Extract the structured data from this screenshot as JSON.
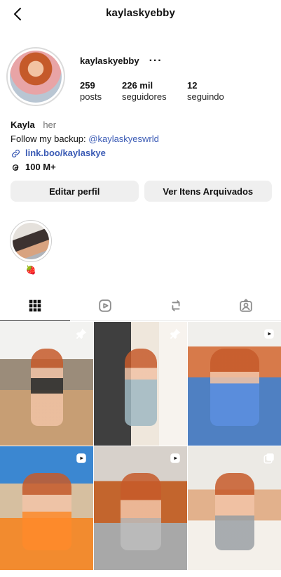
{
  "header": {
    "title": "kaylaskyebby"
  },
  "profile": {
    "username": "kaylaskyebby",
    "more_label": "···",
    "stats": [
      {
        "value": "259",
        "label": "posts"
      },
      {
        "value": "226 mil",
        "label": "seguidores"
      },
      {
        "value": "12",
        "label": "seguindo"
      }
    ],
    "bio": {
      "name": "Kayla",
      "pronouns": "her",
      "line_prefix": "Follow my backup: ",
      "mention": "@kaylaskyeswrld",
      "link": "link.boo/kaylaskye",
      "threads_count": "100 M+"
    },
    "buttons": {
      "edit": "Editar perfil",
      "archived": "Ver Itens Arquivados"
    },
    "highlight": {
      "label": "🍓"
    }
  },
  "tabs": [
    {
      "name": "grid-tab",
      "icon": "grid-icon",
      "active": true
    },
    {
      "name": "reels-tab",
      "icon": "reels-icon",
      "active": false
    },
    {
      "name": "reposts-tab",
      "icon": "repost-icon",
      "active": false
    },
    {
      "name": "tagged-tab",
      "icon": "tagged-icon",
      "active": false
    }
  ],
  "grid": {
    "items": [
      {
        "kind": "photo",
        "badge": "pin-icon"
      },
      {
        "kind": "photo",
        "badge": "pin-icon"
      },
      {
        "kind": "reel",
        "badge": "reel-icon"
      },
      {
        "kind": "reel",
        "badge": "reel-icon"
      },
      {
        "kind": "reel",
        "badge": "reel-icon"
      },
      {
        "kind": "carousel",
        "badge": "carousel-icon"
      }
    ]
  },
  "colors": {
    "link_blue": "#3b5bb5",
    "button_bg": "#efefef",
    "divider": "#e6e6e6"
  }
}
